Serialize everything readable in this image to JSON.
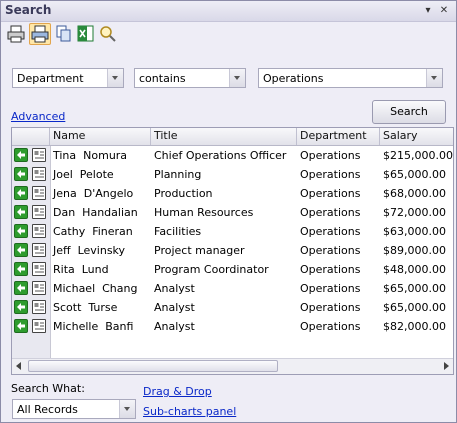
{
  "window": {
    "title": "Search"
  },
  "toolbar": {
    "buttons": [
      {
        "icon": "printer-icon"
      },
      {
        "icon": "print-preview-icon"
      },
      {
        "icon": "copy-icon"
      },
      {
        "icon": "excel-export-icon"
      },
      {
        "icon": "search-reset-icon"
      }
    ]
  },
  "criteria": {
    "field": "Department",
    "operator": "contains",
    "value": "Operations"
  },
  "advanced_link": "Advanced",
  "search_button": "Search",
  "table": {
    "columns": [
      "Name",
      "Title",
      "Department",
      "Salary"
    ],
    "rows": [
      [
        "Tina  Nomura",
        "Chief Operations Officer",
        "Operations",
        "$215,000.00"
      ],
      [
        "Joel  Pelote",
        "Planning",
        "Operations",
        "$65,000.00"
      ],
      [
        "Jena  D'Angelo",
        "Production",
        "Operations",
        "$68,000.00"
      ],
      [
        "Dan  Handalian",
        "Human Resources",
        "Operations",
        "$72,000.00"
      ],
      [
        "Cathy  Fineran",
        "Facilities",
        "Operations",
        "$63,000.00"
      ],
      [
        "Jeff  Levinsky",
        "Project manager",
        "Operations",
        "$89,000.00"
      ],
      [
        "Rita  Lund",
        "Program Coordinator",
        "Operations",
        "$48,000.00"
      ],
      [
        "Michael  Chang",
        "Analyst",
        "Operations",
        "$65,000.00"
      ],
      [
        "Scott  Turse",
        "Analyst",
        "Operations",
        "$65,000.00"
      ],
      [
        "Michelle  Banfi",
        "Analyst",
        "Operations",
        "$82,000.00"
      ]
    ]
  },
  "footer": {
    "search_what_label": "Search What:",
    "search_what_value": "All Records",
    "drag_drop_link": "Drag & Drop",
    "subcharts_link": "Sub-charts panel"
  },
  "colors": {
    "accent_link": "#0a28c8",
    "row_icon_green": "#2e9c2e"
  }
}
